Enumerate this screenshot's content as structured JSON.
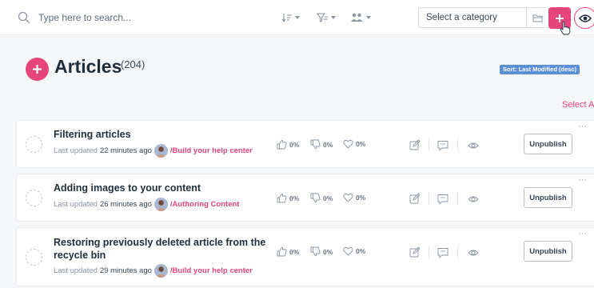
{
  "search": {
    "placeholder": "Type here to search...",
    "value": ""
  },
  "category": {
    "placeholder": "Select a category"
  },
  "page": {
    "title": "Articles",
    "count": "(204)",
    "sort_label": "Sort: Last Modified (desc)",
    "select_all": "Select A"
  },
  "colors": {
    "accent": "#e5457a",
    "text": "#1f2d3d",
    "muted": "#8a94a4",
    "badge": "#5b8fd6"
  },
  "icons": {
    "toolbar": [
      "sort-icon",
      "filter-icon",
      "users-icon"
    ],
    "row_stats": [
      "thumbs-up-icon",
      "thumbs-down-icon",
      "heart-icon"
    ],
    "row_actions": [
      "edit-icon",
      "comment-icon",
      "eye-icon"
    ]
  },
  "articles": [
    {
      "title": "Filtering articles",
      "updated_label": "Last updated",
      "updated_ago": "22 minutes ago",
      "path": "/Build your help center",
      "likes": "0%",
      "dislikes": "0%",
      "loves": "0%",
      "action": "Unpublish",
      "more": "···"
    },
    {
      "title": "Adding images to your content",
      "updated_label": "Last updated",
      "updated_ago": "26 minutes ago",
      "path": "/Authoring Content",
      "likes": "0%",
      "dislikes": "0%",
      "loves": "0%",
      "action": "Unpublish",
      "more": "···"
    },
    {
      "title": "Restoring previously deleted article from the recycle bin",
      "updated_label": "Last updated",
      "updated_ago": "29 minutes ago",
      "path": "/Build your help center",
      "likes": "0%",
      "dislikes": "0%",
      "loves": "0%",
      "action": "Unpublish",
      "more": "···"
    }
  ]
}
